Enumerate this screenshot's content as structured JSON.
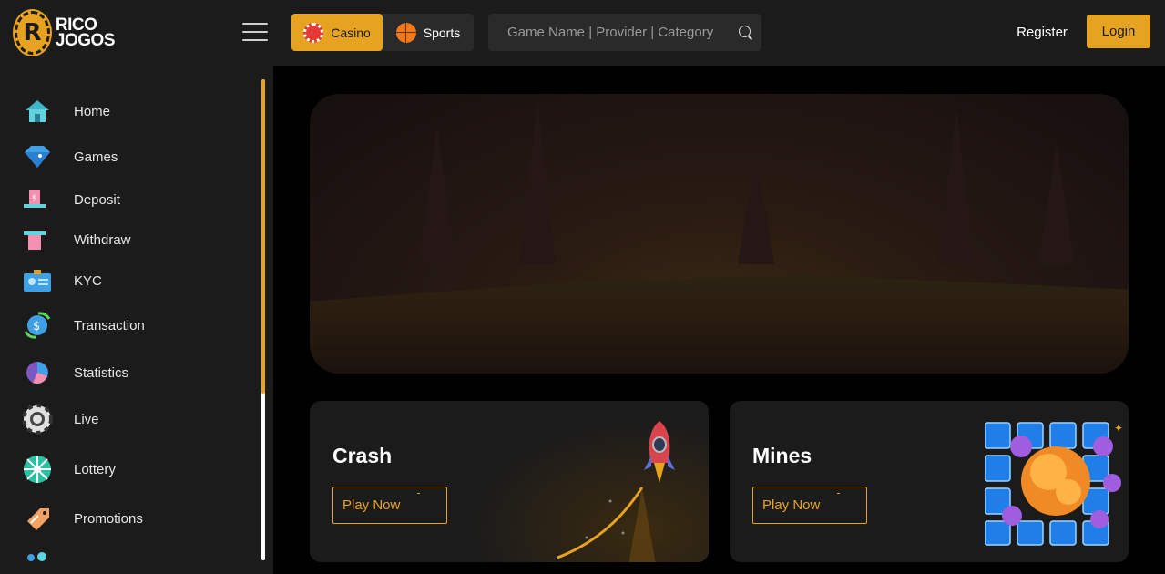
{
  "brand": {
    "name_line1": "RICO",
    "name_line2": "JOGOS",
    "badge": "R"
  },
  "header": {
    "tabs": [
      {
        "label": "Casino",
        "icon": "casino-chip-icon",
        "active": true
      },
      {
        "label": "Sports",
        "icon": "basketball-icon",
        "active": false
      }
    ],
    "search_placeholder": "Game Name | Provider | Category",
    "register_label": "Register",
    "login_label": "Login"
  },
  "sidebar": {
    "items": [
      {
        "label": "Home",
        "icon": "home-icon"
      },
      {
        "label": "Games",
        "icon": "diamond-icon"
      },
      {
        "label": "Deposit",
        "icon": "deposit-icon"
      },
      {
        "label": "Withdraw",
        "icon": "withdraw-icon"
      },
      {
        "label": "KYC",
        "icon": "id-card-icon"
      },
      {
        "label": "Transaction",
        "icon": "coin-exchange-icon"
      },
      {
        "label": "Statistics",
        "icon": "pie-chart-icon"
      },
      {
        "label": "Live",
        "icon": "poker-chip-icon"
      },
      {
        "label": "Lottery",
        "icon": "lottery-wheel-icon"
      },
      {
        "label": "Promotions",
        "icon": "tag-icon"
      }
    ]
  },
  "games": [
    {
      "title": "Crash",
      "cta": "Play Now",
      "art": "rocket-icon"
    },
    {
      "title": "Mines",
      "cta": "Play Now",
      "art": "mines-explosion-icon"
    }
  ],
  "colors": {
    "accent": "#e6a31f",
    "panel": "#1b1b1b",
    "background": "#000000"
  }
}
